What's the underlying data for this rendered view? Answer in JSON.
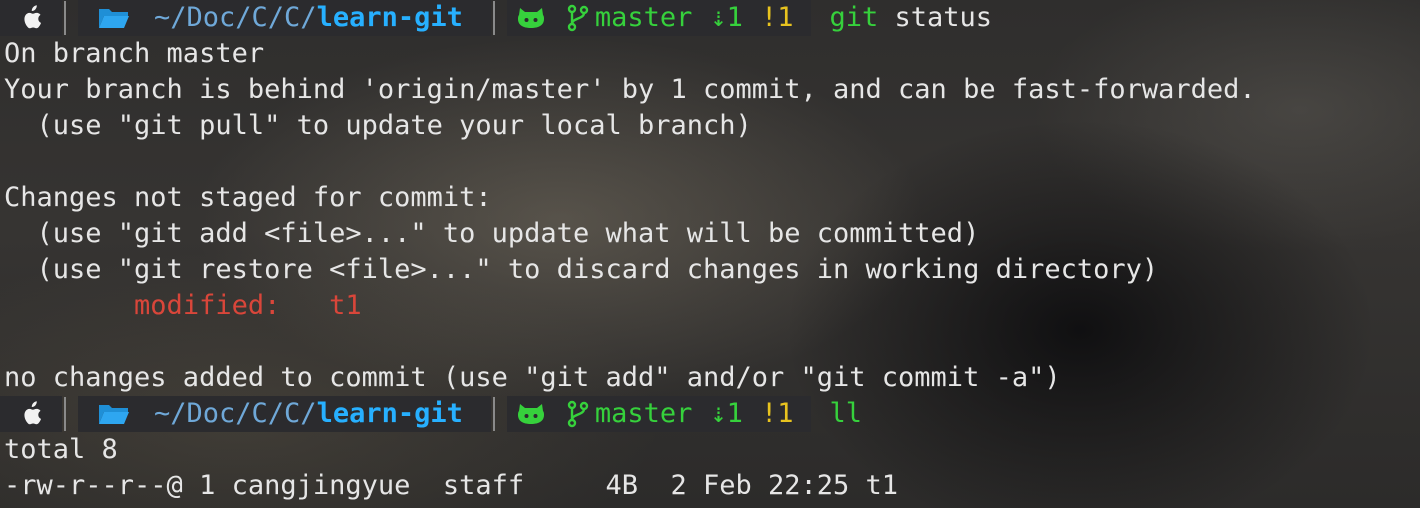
{
  "prompt": {
    "path_prefix": "~/Doc/C/C/",
    "path_dir": "learn-git",
    "branch": "master",
    "behind": "⇣1",
    "modified": "!1"
  },
  "commands": {
    "first_git": "git",
    "first_rest": " status",
    "second": "ll"
  },
  "output": {
    "l1": "On branch master",
    "l2": "Your branch is behind 'origin/master' by 1 commit, and can be fast-forwarded.",
    "l3": "  (use \"git pull\" to update your local branch)",
    "l4": "",
    "l5": "Changes not staged for commit:",
    "l6": "  (use \"git add <file>...\" to update what will be committed)",
    "l7": "  (use \"git restore <file>...\" to discard changes in working directory)",
    "l8_prefix": "        ",
    "l8_mod": "modified:   t1",
    "l9": "",
    "l10": "no changes added to commit (use \"git add\" and/or \"git commit -a\")",
    "l11": "total 8",
    "l12": "-rw-r--r--@ 1 cangjingyue  staff     4B  2 Feb 22:25 t1"
  },
  "colors": {
    "accent_blue": "#27b0ff",
    "git_green": "#36d13c",
    "warn_yellow": "#e8c31f",
    "modified_red": "#d9463a"
  },
  "icons": [
    "apple-icon",
    "folder-icon",
    "github-icon",
    "branch-icon"
  ]
}
